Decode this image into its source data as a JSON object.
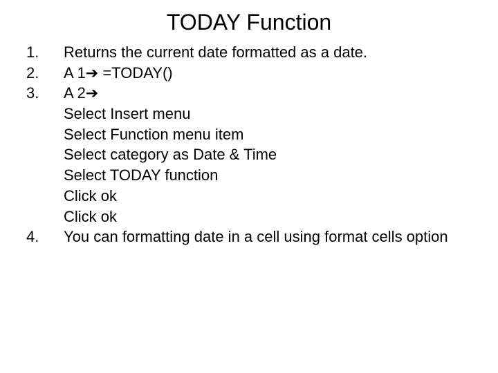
{
  "title": "TODAY Function",
  "items": {
    "n1": "1.",
    "t1": "Returns the current date formatted as a date.",
    "n2": "2.",
    "t2": "A 1➔ =TODAY()",
    "n3": "3.",
    "t3": "A 2➔",
    "s1": "Select Insert menu",
    "s2": "Select Function menu item",
    "s3": "Select category as Date & Time",
    "s4": "Select TODAY function",
    "s5": "Click ok",
    "s6": "Click ok",
    "n4": "4.",
    "t4": "You can formatting date in a cell using format cells option"
  }
}
